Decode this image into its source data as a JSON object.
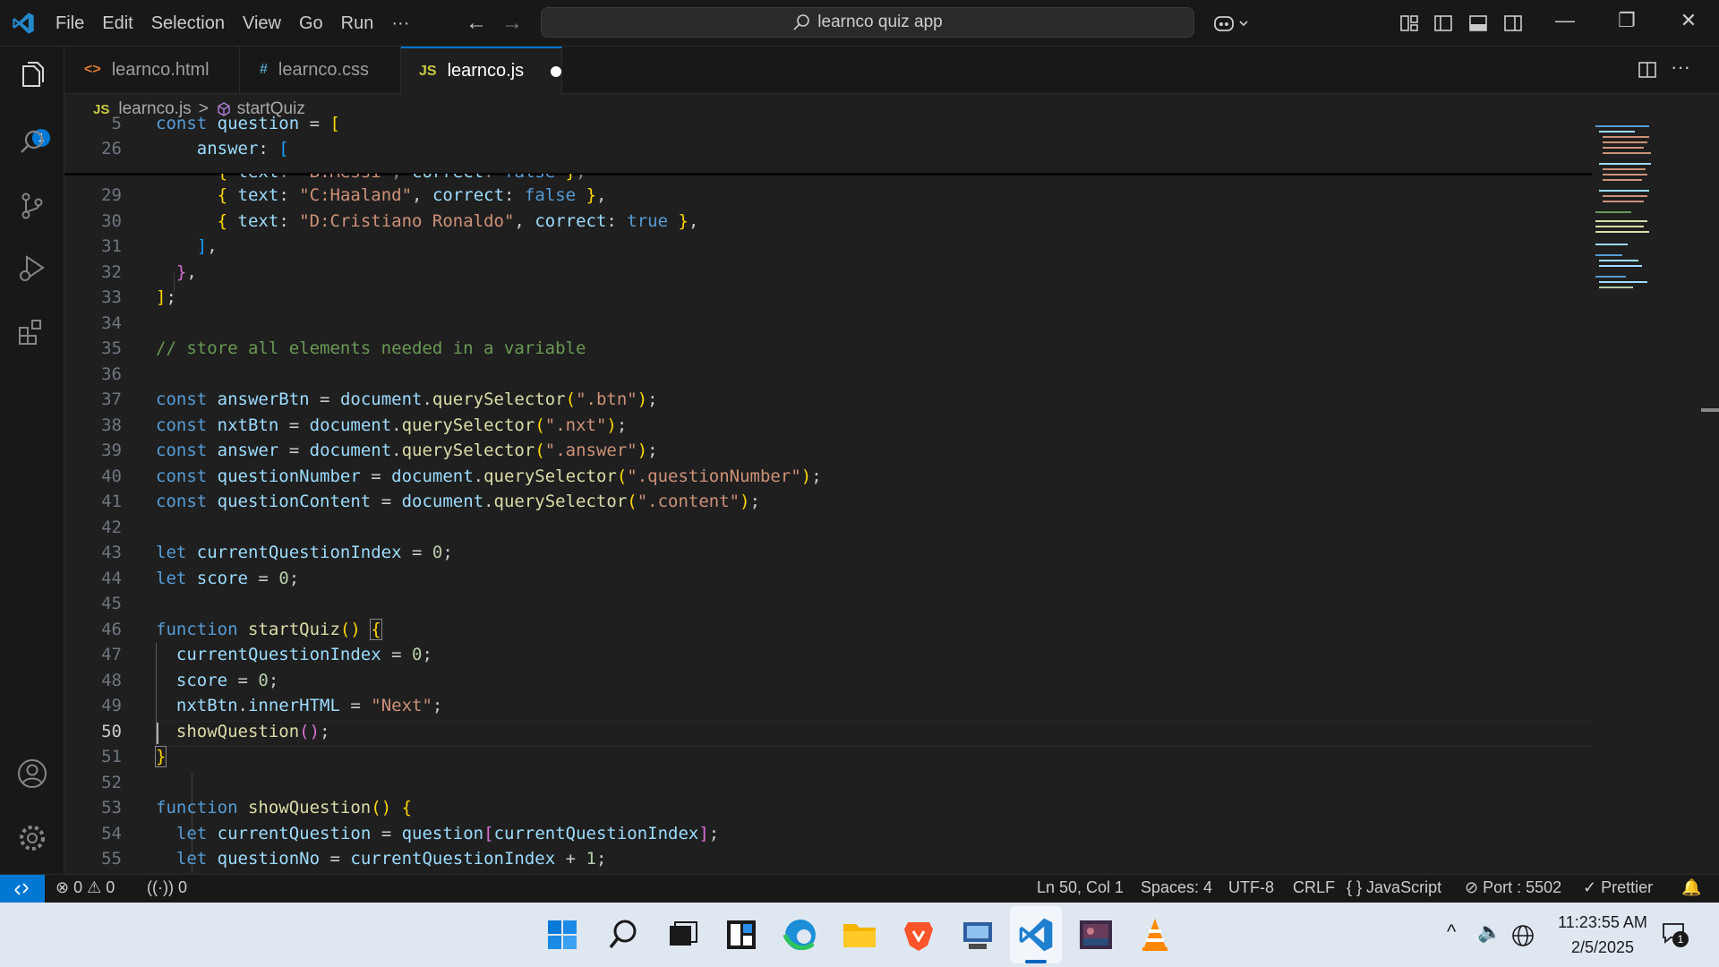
{
  "titlebar": {
    "menu": [
      "File",
      "Edit",
      "Selection",
      "View",
      "Go",
      "Run",
      "···"
    ],
    "search_text": "learnco quiz app",
    "window_controls": [
      "—",
      "❐",
      "✕"
    ]
  },
  "activity": {
    "explorer_badge": "1"
  },
  "tabs": [
    {
      "icon": "<>",
      "label": "learnco.html"
    },
    {
      "icon": "#",
      "label": "learnco.css"
    },
    {
      "icon": "JS",
      "label": "learnco.js"
    }
  ],
  "breadcrumb": {
    "file_icon": "JS",
    "file": "learnco.js",
    "sep": ">",
    "symbol": "startQuiz"
  },
  "editor": {
    "lines": [
      {
        "n": "5",
        "code": "const question = ["
      },
      {
        "n": "26",
        "code": "    answer: ["
      },
      {
        "n": "29",
        "code": "      { text: \"C:Haaland\", correct: false },"
      },
      {
        "n": "30",
        "code": "      { text: \"D:Cristiano Ronaldo\", correct: true },"
      },
      {
        "n": "31",
        "code": "    ],"
      },
      {
        "n": "32",
        "code": "  },"
      },
      {
        "n": "33",
        "code": "];"
      },
      {
        "n": "34",
        "code": ""
      },
      {
        "n": "35",
        "code": "// store all elements needed in a variable"
      },
      {
        "n": "36",
        "code": ""
      },
      {
        "n": "37",
        "code": "const answerBtn = document.querySelector(\".btn\");"
      },
      {
        "n": "38",
        "code": "const nxtBtn = document.querySelector(\".nxt\");"
      },
      {
        "n": "39",
        "code": "const answer = document.querySelector(\".answer\");"
      },
      {
        "n": "40",
        "code": "const questionNumber = document.querySelector(\".questionNumber\");"
      },
      {
        "n": "41",
        "code": "const questionContent = document.querySelector(\".content\");"
      },
      {
        "n": "42",
        "code": ""
      },
      {
        "n": "43",
        "code": "let currentQuestionIndex = 0;"
      },
      {
        "n": "44",
        "code": "let score = 0;"
      },
      {
        "n": "45",
        "code": ""
      },
      {
        "n": "46",
        "code": "function startQuiz() {"
      },
      {
        "n": "47",
        "code": "  currentQuestionIndex = 0;"
      },
      {
        "n": "48",
        "code": "  score = 0;"
      },
      {
        "n": "49",
        "code": "  nxtBtn.innerHTML = \"Next\";"
      },
      {
        "n": "50",
        "code": "  showQuestion();"
      },
      {
        "n": "51",
        "code": "}"
      },
      {
        "n": "52",
        "code": ""
      },
      {
        "n": "53",
        "code": "function showQuestion() {"
      },
      {
        "n": "54",
        "code": "  let currentQuestion = question[currentQuestionIndex];"
      },
      {
        "n": "55",
        "code": "  let questionNo = currentQuestionIndex + 1;"
      }
    ]
  },
  "statusbar": {
    "errors": "0",
    "warnings": "0",
    "ports": "0",
    "position": "Ln 50, Col 1",
    "spaces": "Spaces: 4",
    "encoding": "UTF-8",
    "eol": "CRLF",
    "language": "JavaScript",
    "language_icon": "{ }",
    "port": "Port : 5502",
    "prettier": "Prettier"
  },
  "taskbar": {
    "time": "11:23:55 AM",
    "date": "2/5/2025",
    "notif_count": "1"
  },
  "colors": {
    "accent": "#0078d4",
    "keyword": "#569cd6",
    "string": "#ce9178",
    "comment": "#6a9955",
    "function": "#dcdcaa",
    "variable": "#9cdcfe"
  }
}
